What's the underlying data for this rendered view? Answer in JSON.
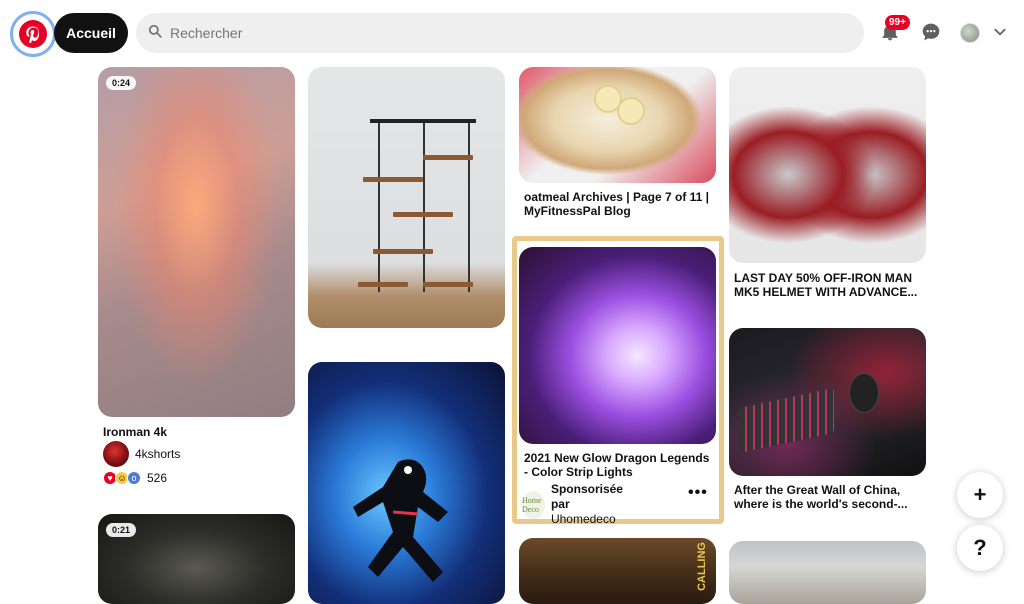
{
  "header": {
    "logo": "pinterest-logo-icon",
    "home_label": "Accueil",
    "search_placeholder": "Rechercher",
    "notifications_badge": "99+",
    "icons": [
      "bell-icon",
      "chat-bubble-icon",
      "avatar",
      "chevron-down-icon"
    ]
  },
  "pins": {
    "ironman": {
      "duration": "0:24",
      "title": "Ironman 4k",
      "creator": "4kshorts",
      "reactions_count": "526"
    },
    "oatmeal": {
      "title": "oatmeal Archives | Page 7 of 11 | MyFitnessPal Blog"
    },
    "helmet": {
      "title": "LAST DAY 50% OFF-IRON MAN MK5 HELMET WITH ADVANCE..."
    },
    "dragon": {
      "title": "2021 New Glow Dragon Legends - Color Strip Lights",
      "sponsored_label": "Sponsorisée par",
      "sponsor": "Uhomedeco",
      "sponsor_logo_text": "Home Deco",
      "more": "•••"
    },
    "keyboard": {
      "title": "After the Great Wall of China, where is the world's second-..."
    },
    "dark": {
      "duration": "0:21"
    },
    "food": {
      "overlay_text": "CALLING"
    }
  },
  "fab": {
    "add": "+",
    "help": "?"
  },
  "colors": {
    "brand": "#e60023",
    "sponsored_border": "#e9c98a",
    "search_bg": "#efefef"
  }
}
